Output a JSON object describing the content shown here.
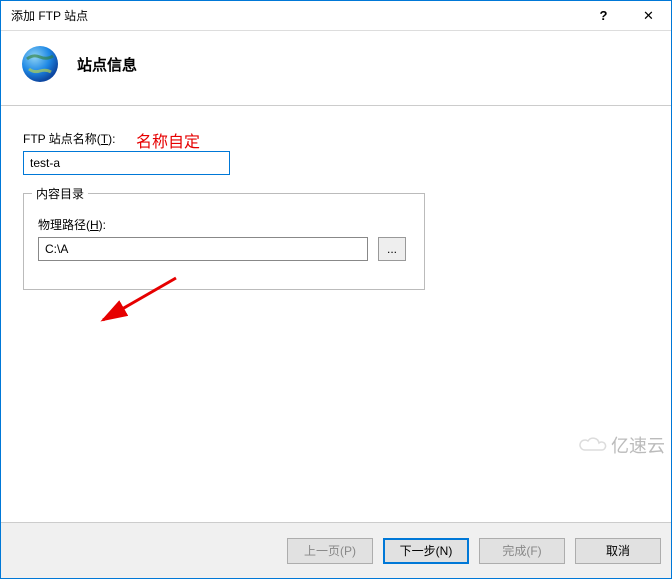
{
  "titlebar": {
    "title": "添加 FTP 站点",
    "help": "?",
    "close": "✕"
  },
  "header": {
    "title": "站点信息"
  },
  "form": {
    "siteNameLabelPrefix": "FTP 站点名称(",
    "siteNameAccel": "T",
    "siteNameLabelSuffix": "):",
    "siteNameValue": "test-a",
    "annotation": "名称自定",
    "contentDirLegend": "内容目录",
    "physicalPathLabelPrefix": "物理路径(",
    "physicalPathAccel": "H",
    "physicalPathLabelSuffix": "):",
    "physicalPathValue": "C:\\A",
    "browseLabel": "..."
  },
  "footer": {
    "prev": "上一页(P)",
    "next": "下一步(N)",
    "finish": "完成(F)",
    "cancel": "取消"
  },
  "watermark": "亿速云"
}
